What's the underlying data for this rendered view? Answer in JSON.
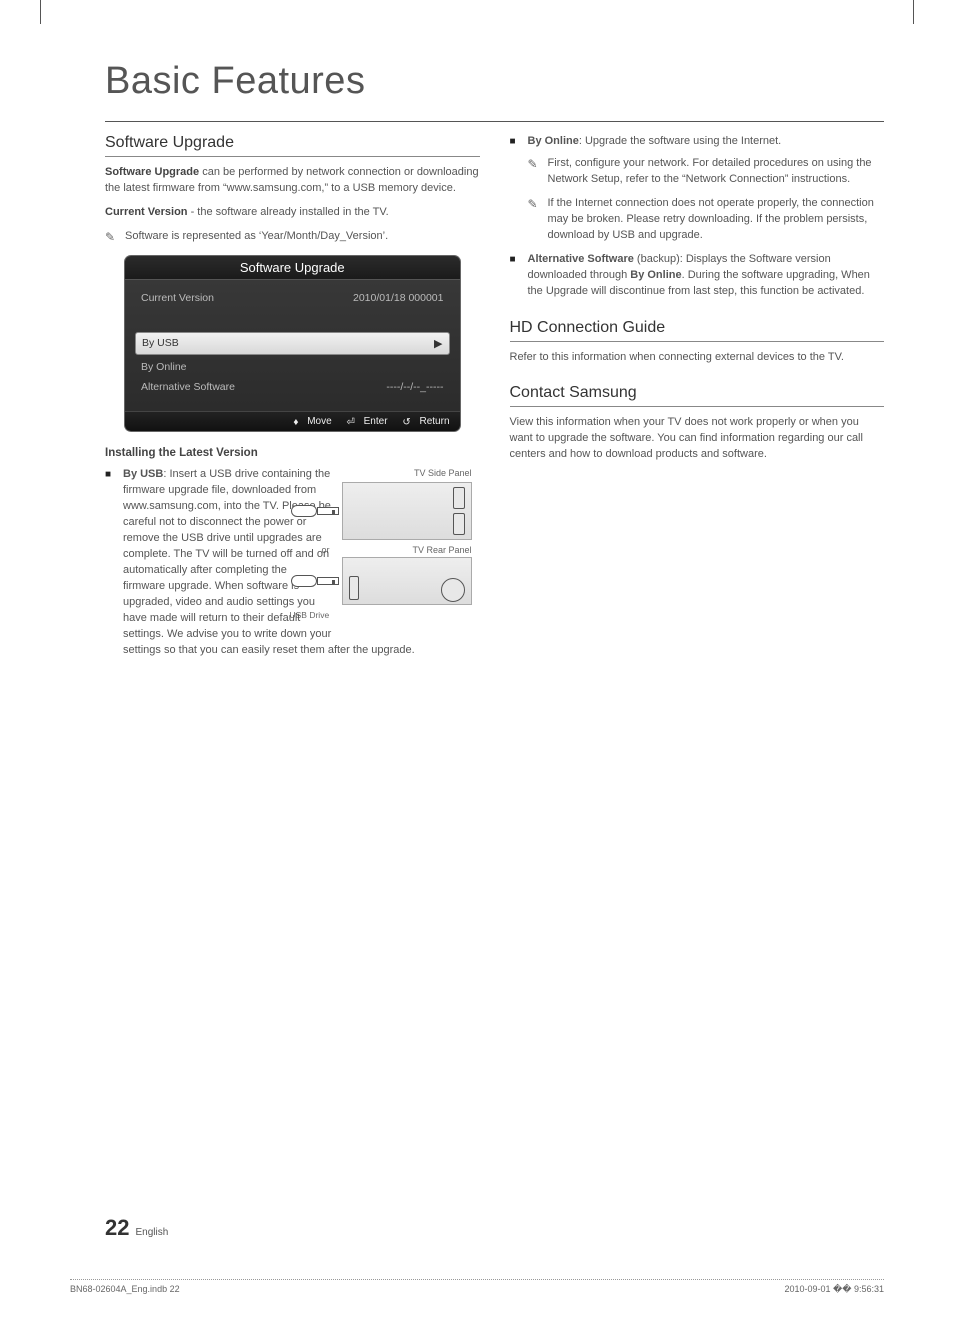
{
  "title": "Basic Features",
  "left": {
    "section1": {
      "heading": "Software Upgrade",
      "p1_bold": "Software Upgrade",
      "p1_rest": " can be performed by network connection or downloading the latest firmware from “www.samsung.com,” to a USB memory device.",
      "p2_bold": "Current Version",
      "p2_rest": " - the software already installed in the TV.",
      "note1": "Software is represented as ‘Year/Month/Day_Version’."
    },
    "osd": {
      "title": "Software Upgrade",
      "row_current_label": "Current Version",
      "row_current_value": "2010/01/18 000001",
      "row_usb": "By USB",
      "row_online": "By Online",
      "row_alt_label": "Alternative Software",
      "row_alt_value": "----/--/--_-----",
      "footer_move": "Move",
      "footer_enter": "Enter",
      "footer_return": "Return"
    },
    "install": {
      "heading": "Installing the Latest Version",
      "usb_bold": "By USB",
      "usb_rest": ": Insert a USB drive containing the firmware upgrade file, downloaded from www.samsung.com, into the TV. Please be careful not to disconnect the power or remove the USB drive until upgrades are complete. The TV will be turned off and on automatically after completing the firmware upgrade. When software is upgraded, video and audio settings you have made will return to their default settings. We advise you to write down your settings so that you can easily reset them after the upgrade.",
      "diag_side": "TV Side Panel",
      "diag_or": "or",
      "diag_rear": "TV Rear Panel",
      "diag_usbdrive": "USB Drive"
    }
  },
  "right": {
    "online_bold": "By Online",
    "online_rest": ": Upgrade the software using the Internet.",
    "online_note1": "First, configure your network. For detailed procedures on using the Network Setup, refer to the “Network Connection” instructions.",
    "online_note2": "If the Internet connection does not operate properly, the connection may be broken. Please retry downloading. If the problem persists, download by USB and upgrade.",
    "alt_bold": "Alternative Software",
    "alt_mid": " (backup): Displays the Software version downloaded through ",
    "alt_bold2": "By Online",
    "alt_end": ". During the software upgrading, When the Upgrade will discontinue from last step, this function be activated.",
    "hd_heading": "HD Connection Guide",
    "hd_text": "Refer to this information when connecting external devices to the TV.",
    "contact_heading": "Contact Samsung",
    "contact_text": "View this information when your TV does not work properly or when you want to upgrade the software. You can find information regarding our call centers and how to download products and software."
  },
  "footer": {
    "page": "22",
    "lang": "English",
    "indb": "BN68-02604A_Eng.indb   22",
    "timestamp": "2010-09-01   �� 9:56:31"
  }
}
